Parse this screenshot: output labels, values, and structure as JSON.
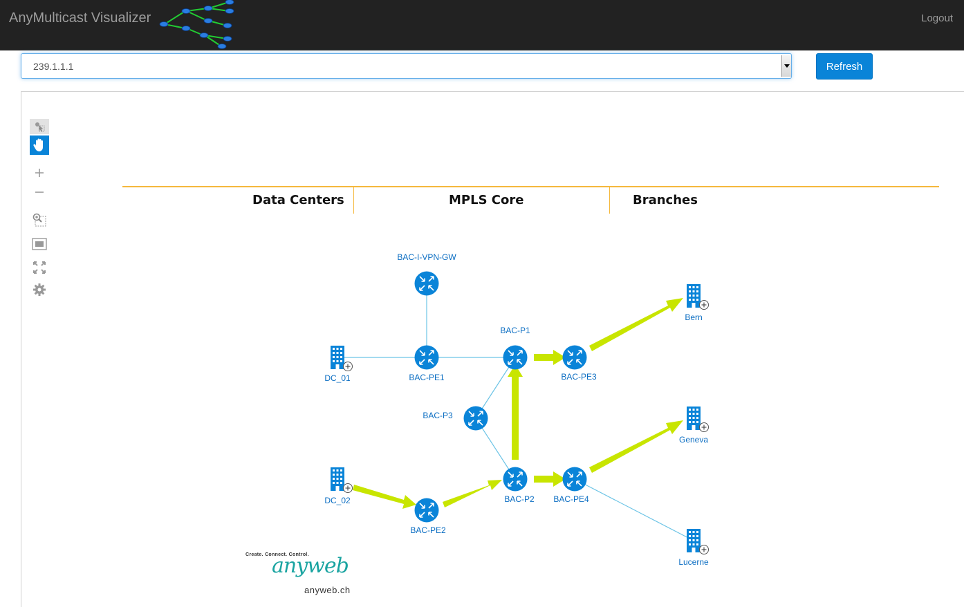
{
  "header": {
    "brand": "AnyMulticast Visualizer",
    "logout_label": "Logout"
  },
  "group_select": {
    "value": "239.1.1.1"
  },
  "refresh_label": "Refresh",
  "toolbar": {
    "tools": [
      "select-tool-icon",
      "pan-tool-icon",
      "zoom-in-icon",
      "zoom-out-icon",
      "zoom-selection-icon",
      "fit-view-icon",
      "fullscreen-icon",
      "settings-icon"
    ]
  },
  "sections": {
    "data_centers": "Data Centers",
    "mpls_core": "MPLS Core",
    "branches": "Branches"
  },
  "nodes": {
    "bac_i_vpn_gw": "BAC-I-VPN-GW",
    "bac_pe1": "BAC-PE1",
    "bac_p1": "BAC-P1",
    "bac_pe3": "BAC-PE3",
    "bac_p3": "BAC-P3",
    "bac_p2": "BAC-P2",
    "bac_pe4": "BAC-PE4",
    "bac_pe2": "BAC-PE2",
    "dc_01": "DC_01",
    "dc_02": "DC_02",
    "bern": "Bern",
    "geneva": "Geneva",
    "lucerne": "Lucerne"
  },
  "colors": {
    "accent": "#0a84d8",
    "router": "#0a84d8",
    "stream": "#c8e500",
    "link": "#6cc4e6",
    "section_line": "#f5b83d"
  },
  "footer_logo": {
    "tagline": "Create. Connect. Control.",
    "script": "anyweb",
    "url": "anyweb.ch"
  }
}
